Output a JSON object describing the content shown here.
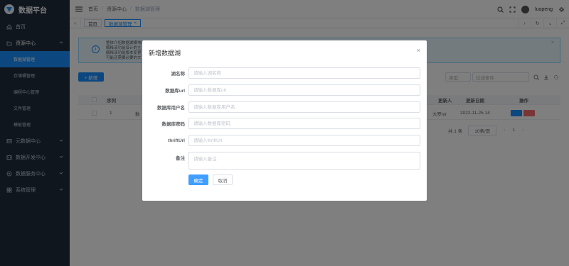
{
  "app": {
    "title": "数据平台"
  },
  "sidebar": {
    "items": [
      {
        "label": "首页",
        "icon": "home-icon"
      },
      {
        "label": "资源中心",
        "icon": "folder-icon",
        "expanded": true,
        "children": [
          {
            "label": "数据湖管理",
            "active": true
          },
          {
            "label": "存储桶管理"
          },
          {
            "label": "编程中心管理"
          },
          {
            "label": "文件管理"
          },
          {
            "label": "模板管理"
          }
        ]
      },
      {
        "label": "元数据中心",
        "icon": "database-icon"
      },
      {
        "label": "数据开发中心",
        "icon": "code-icon"
      },
      {
        "label": "数据服务中心",
        "icon": "service-icon"
      },
      {
        "label": "系统管理",
        "icon": "settings-grid-icon"
      }
    ]
  },
  "header": {
    "breadcrumbs": [
      "首页",
      "资源中心",
      "数据湖管理"
    ],
    "user": "luopeng"
  },
  "tags": {
    "items": [
      {
        "label": "首页",
        "active": false
      },
      {
        "label": "数据湖管理",
        "active": true,
        "closable": "×"
      }
    ]
  },
  "main": {
    "alert_lines": [
      "整体介绍数据湖模块的主",
      "解释该功能设计的主",
      "解释该功能版本变更",
      "可能还需要必要的文"
    ],
    "alert_close": "×",
    "add_button": "+ 新增",
    "filter_select_placeholder": "类型",
    "filter_input_placeholder": "过滤条件",
    "table": {
      "headers": {
        "index": "序列",
        "name": "",
        "updater": "更新人",
        "updated": "更新日期",
        "actions": "操作"
      },
      "rows": [
        {
          "index": "1",
          "name": "数",
          "updater": "大罗sir",
          "updated": "2022-11-25 14"
        }
      ]
    },
    "pager": {
      "total": "共 1 条",
      "page_size": "10条/页",
      "prev": "‹",
      "page": "1",
      "next": "›"
    }
  },
  "modal": {
    "title": "新增数据湖",
    "close": "×",
    "fields": [
      {
        "label": "湖名称",
        "placeholder": "请输入湖名称"
      },
      {
        "label": "数据库url",
        "placeholder": "请输入数据库url"
      },
      {
        "label": "数据库用户名",
        "placeholder": "请输入数据库用户名"
      },
      {
        "label": "数据库密码",
        "placeholder": "请输入数据库密码"
      },
      {
        "label": "thriftUrl",
        "placeholder": "请输入thriftUrl"
      },
      {
        "label": "备注",
        "placeholder": "请输入备注"
      }
    ],
    "confirm": "确定",
    "cancel": "取消"
  },
  "colors": {
    "primary": "#1890ff",
    "sidebar_bg": "#1f2d3d",
    "danger": "#f56c6c"
  }
}
